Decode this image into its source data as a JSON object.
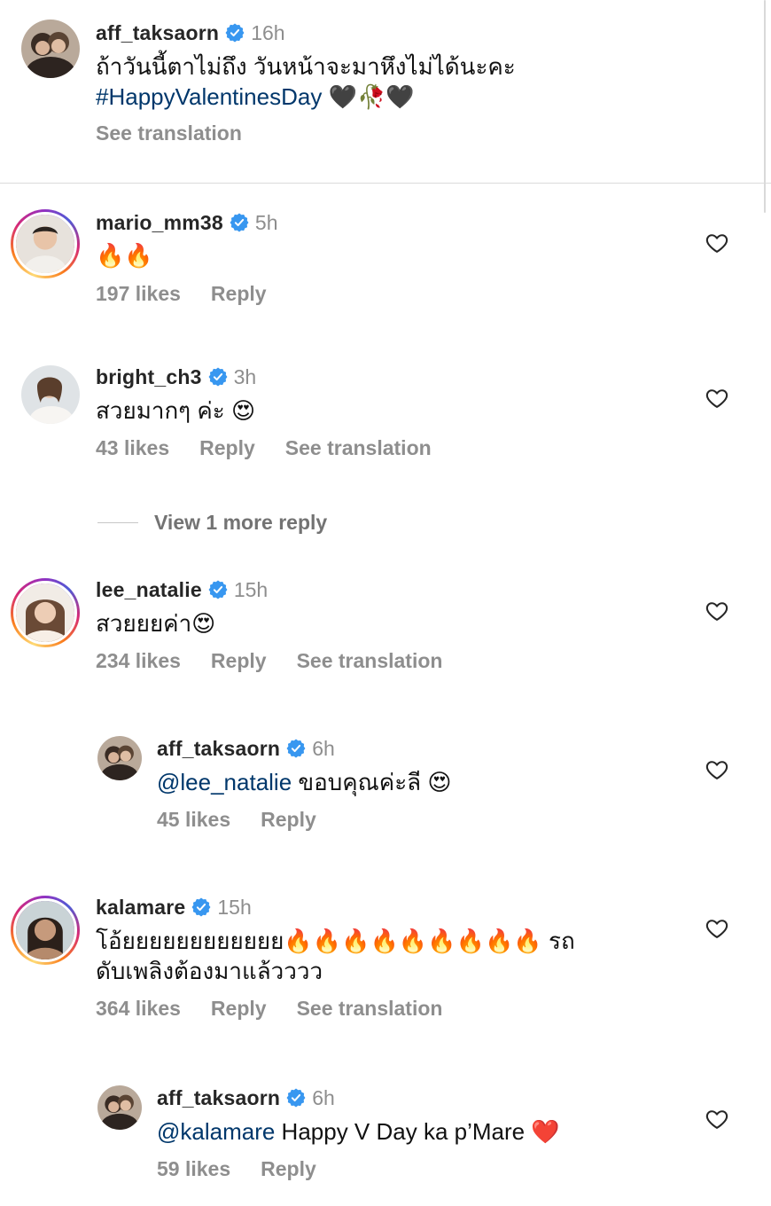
{
  "caption": {
    "username": "aff_taksaorn",
    "time": "16h",
    "text_line1": "ถ้าวันนี้ตาไม่ถึง วันหน้าจะมาหึงไม่ได้นะคะ",
    "hashtag": "#HappyValentinesDay",
    "emojis": "🖤🥀🖤",
    "see_translation": "See translation"
  },
  "comments": [
    {
      "username": "mario_mm38",
      "time": "5h",
      "text": "🔥🔥",
      "likes": "197 likes",
      "reply": "Reply"
    },
    {
      "username": "bright_ch3",
      "time": "3h",
      "text": "สวยมากๆ ค่ะ 😍",
      "likes": "43 likes",
      "reply": "Reply",
      "see_translation": "See translation",
      "view_more": "View 1 more reply"
    },
    {
      "username": "lee_natalie",
      "time": "15h",
      "text": "สวยยยค่า😍",
      "likes": "234 likes",
      "reply": "Reply",
      "see_translation": "See translation",
      "reply_item": {
        "username": "aff_taksaorn",
        "time": "6h",
        "mention": "@lee_natalie",
        "text": " ขอบคุณค่ะลี 😍",
        "likes": "45 likes",
        "reply": "Reply"
      }
    },
    {
      "username": "kalamare",
      "time": "15h",
      "text_line1": "โอ้ยยยยยยยยยยยย🔥🔥🔥🔥🔥🔥🔥🔥🔥 รถ",
      "text_line2": "ดับเพลิงต้องมาแล้วววว",
      "likes": "364 likes",
      "reply": "Reply",
      "see_translation": "See translation",
      "reply_item": {
        "username": "aff_taksaorn",
        "time": "6h",
        "mention": "@kalamare",
        "text": " Happy V Day ka p’Mare ❤️",
        "likes": "59 likes",
        "reply": "Reply"
      }
    }
  ],
  "colors": {
    "verified": "#3897f0",
    "link": "#00376b",
    "meta": "#8e8e8e"
  },
  "icons": [
    "verified-badge-icon",
    "heart-outline-icon"
  ]
}
